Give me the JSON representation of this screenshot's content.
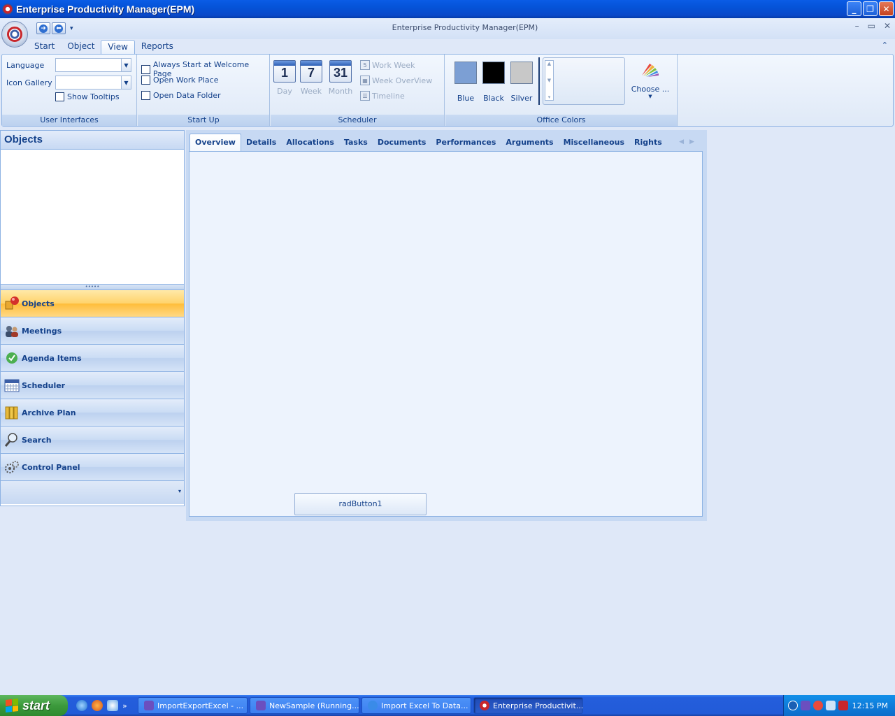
{
  "window": {
    "title": "Enterprise Productivity Manager(EPM)",
    "caption": "Enterprise Productivity Manager(EPM)",
    "min": "_",
    "max": "❐",
    "close": "✕",
    "inner_min": "–",
    "inner_max": "▭",
    "inner_close": "✕"
  },
  "ribbon": {
    "tabs": [
      "Start",
      "Object",
      "View",
      "Reports"
    ],
    "active_tab": "View",
    "collapse_glyph": "⌃",
    "groups": {
      "user_interfaces": {
        "label": "User Interfaces",
        "language_label": "Language",
        "language_value": "",
        "icon_gallery_label": "Icon Gallery",
        "icon_gallery_value": "",
        "show_tooltips": "Show Tooltips"
      },
      "start_up": {
        "label": "Start Up",
        "options": [
          "Always Start at Welcome Page",
          "Open Work Place",
          "Open Data Folder"
        ]
      },
      "scheduler": {
        "label": "Scheduler",
        "day": "Day",
        "day_num": "1",
        "week": "Week",
        "week_num": "7",
        "month": "Month",
        "month_num": "31",
        "work_week": "Work Week",
        "work_week_num": "5",
        "week_overview": "Week OverView",
        "timeline": "Timeline"
      },
      "office_colors": {
        "label": "Office Colors",
        "swatches": [
          {
            "label": "Blue",
            "color": "#7c9fd4"
          },
          {
            "label": "Black",
            "color": "#000000"
          },
          {
            "label": "Silver",
            "color": "#c8c8c8"
          }
        ],
        "choose": "Choose ..."
      }
    }
  },
  "nav": {
    "header": "Objects",
    "items": [
      {
        "label": "Objects",
        "icon": "objects-icon"
      },
      {
        "label": "Meetings",
        "icon": "meetings-icon"
      },
      {
        "label": "Agenda Items",
        "icon": "agenda-icon"
      },
      {
        "label": "Scheduler",
        "icon": "scheduler-icon"
      },
      {
        "label": "Archive Plan",
        "icon": "archive-icon"
      },
      {
        "label": "Search",
        "icon": "search-icon"
      },
      {
        "label": "Control Panel",
        "icon": "control-panel-icon"
      }
    ],
    "active": "Objects"
  },
  "pageview": {
    "tabs": [
      "Overview",
      "Details",
      "Allocations",
      "Tasks",
      "Documents",
      "Performances",
      "Arguments",
      "Miscellaneous",
      "Rights"
    ],
    "active_tab": "Overview",
    "button": "radButton1"
  },
  "taskbar": {
    "start": "start",
    "tasks": [
      {
        "label": "ImportExportExcel - ...",
        "active": false
      },
      {
        "label": "NewSample (Running...",
        "active": false
      },
      {
        "label": "Import Excel To Data...",
        "active": false
      },
      {
        "label": "Enterprise Productivit...",
        "active": true
      }
    ],
    "more": "»",
    "clock": "12:15 PM"
  },
  "colors": {
    "accent": "#15428b",
    "active_nav": "#ffc24a",
    "titlebar": "#0553d8"
  }
}
